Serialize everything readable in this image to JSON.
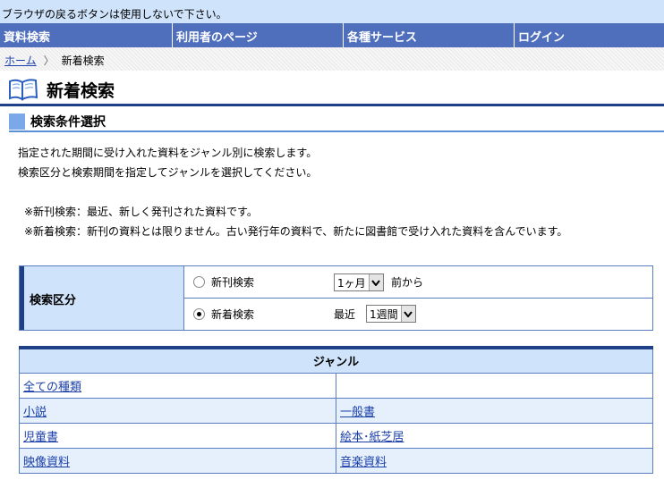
{
  "notice": "ブラウザの戻るボタンは使用しないで下さい。",
  "nav": [
    {
      "label": "資料検索"
    },
    {
      "label": "利用者のページ"
    },
    {
      "label": "各種サービス"
    },
    {
      "label": "ログイン"
    }
  ],
  "breadcrumb": {
    "home": "ホーム",
    "sep": "〉",
    "current": "新着検索"
  },
  "page_title": "新着検索",
  "section_title": "検索条件選択",
  "desc": [
    "指定された期間に受け入れた資料をジャンル別に検索します。",
    "検索区分と検索期間を指定してジャンルを選択してください。"
  ],
  "notes": [
    "※新刊検索：最近、新しく発刊された資料です。",
    "※新着検索：新刊の資料とは限りません。古い発行年の資料で、新たに図書館で受け入れた資料を含んでいます。"
  ],
  "condition": {
    "label": "検索区分",
    "option1": {
      "label": "新刊検索",
      "select_value": "1ヶ月",
      "suffix": "前から",
      "checked": false
    },
    "option2": {
      "label": "新着検索",
      "prefix": "最近",
      "select_value": "1週間",
      "checked": true
    }
  },
  "genre": {
    "header": "ジャンル",
    "rows": [
      [
        "全ての種類",
        ""
      ],
      [
        "小説",
        "一般書"
      ],
      [
        "児童書",
        "絵本･紙芝居"
      ],
      [
        "映像資料",
        "音楽資料"
      ]
    ]
  }
}
